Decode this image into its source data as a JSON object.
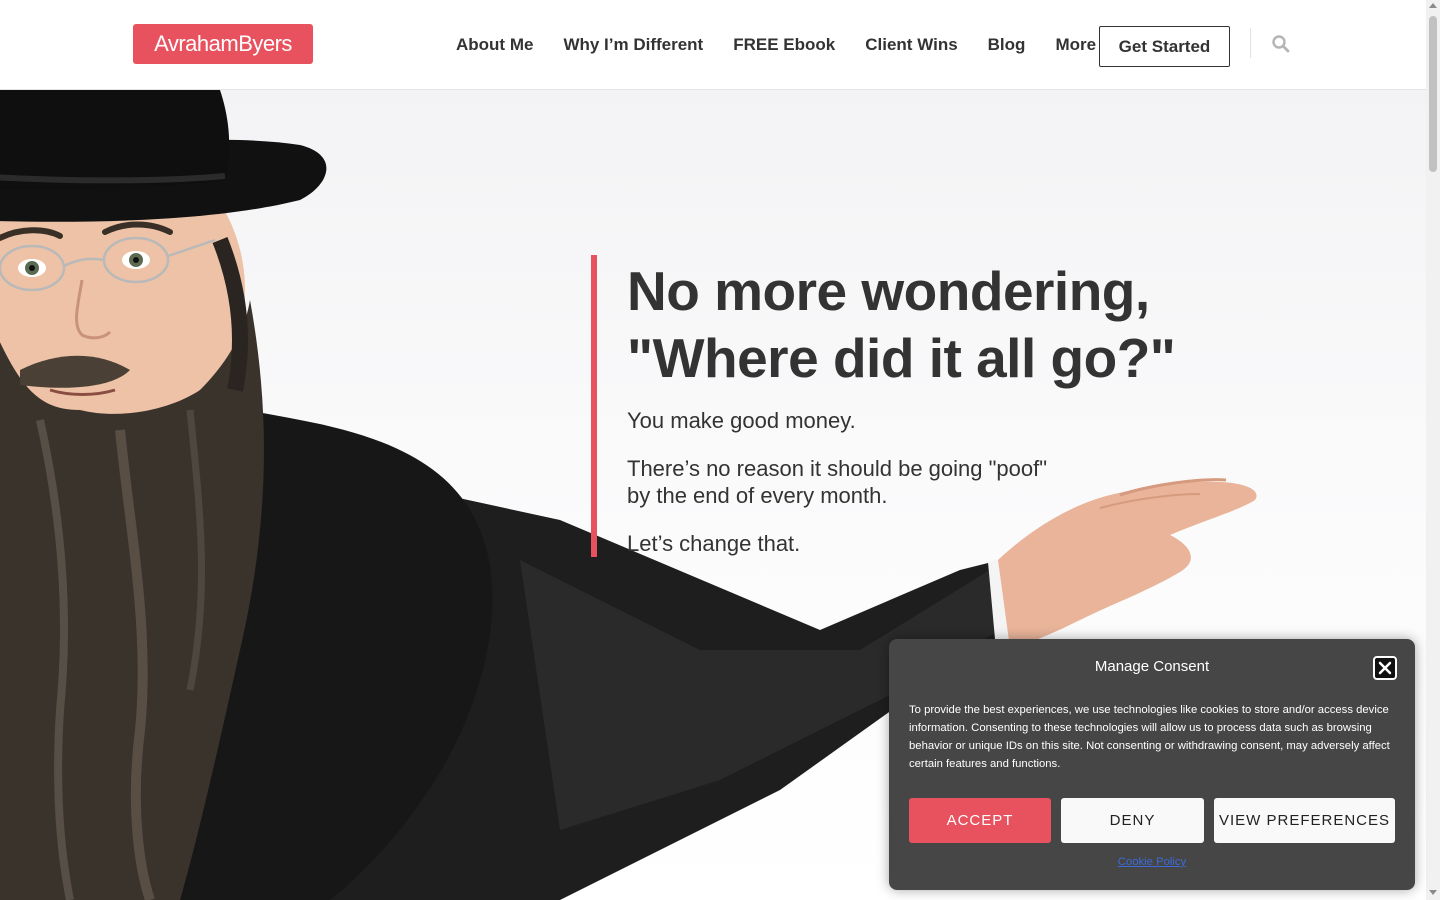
{
  "header": {
    "logo": "AvrahamByers",
    "nav": [
      "About Me",
      "Why I’m Different",
      "FREE Ebook",
      "Client Wins",
      "Blog",
      "More"
    ],
    "cta": "Get Started",
    "search_icon": "search-icon"
  },
  "hero": {
    "headline_line1": "No more wondering,",
    "headline_line2": "\"Where did it all go?\"",
    "para1": "You make good money.",
    "para2_line1": "There’s no reason it should be going \"poof\"",
    "para2_line2": "by the end of every month.",
    "para3": "Let’s change that."
  },
  "consent": {
    "title": "Manage Consent",
    "text": "To provide the best experiences, we use technologies like cookies to store and/or access device information. Consenting to these technologies will allow us to process data such as browsing behavior or unique IDs on this site. Not consenting or withdrawing consent, may adversely affect certain features and functions.",
    "accept": "ACCEPT",
    "deny": "DENY",
    "preferences": "VIEW PREFERENCES",
    "cookie_policy": "Cookie Policy"
  },
  "colors": {
    "brand": "#e8525f",
    "text": "#333333",
    "consent_bg": "#464646"
  }
}
